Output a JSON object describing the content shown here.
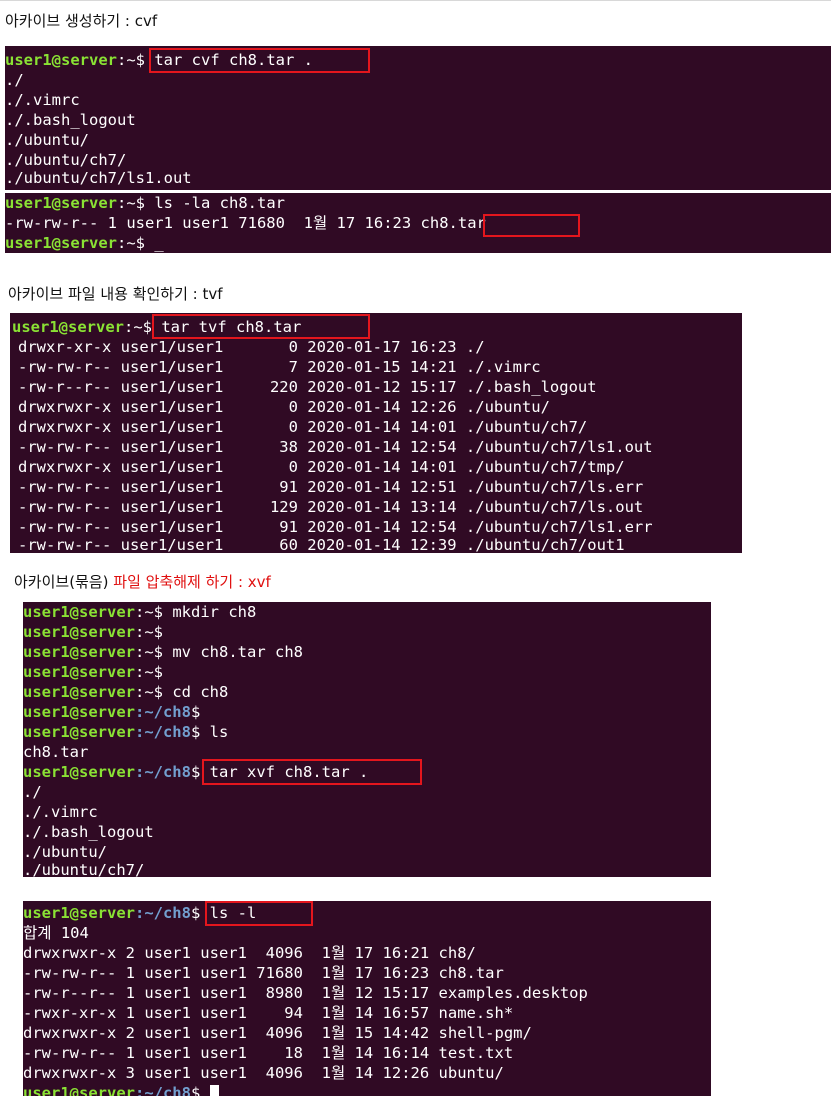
{
  "headings": {
    "create": "아카이브 생성하기 : cvf",
    "list": "아카이브 파일 내용 확인하기 : tvf",
    "extract_prefix": "아카이브(묶음) ",
    "extract_red": "파일 압축해제 하기 : xvf"
  },
  "prompt": {
    "user": "user1@server",
    "home_suffix": ":~",
    "ch8_suffix": ":~/ch8",
    "ch8_partial": ":~/ch",
    "dollar": "$"
  },
  "terminal_create": {
    "command": " tar cvf ch8.tar .",
    "output": [
      "./",
      "./.vimrc",
      "./.bash_logout",
      "./ubuntu/",
      "./ubuntu/ch7/",
      "./ubuntu/ch7/ls1.out"
    ]
  },
  "terminal_ls_la": {
    "command": " ls -la ch8.tar",
    "output_prefix": "-rw-rw-r-- 1 user1 user1 71680  1월 17 16:23 ",
    "output_file": "ch8.tar",
    "trailing": " _"
  },
  "terminal_tvf": {
    "command": " tar tvf ch8.tar",
    "rows": [
      "drwxr-xr-x user1/user1       0 2020-01-17 16:23 ./",
      "-rw-rw-r-- user1/user1       7 2020-01-15 14:21 ./.vimrc",
      "-rw-r--r-- user1/user1     220 2020-01-12 15:17 ./.bash_logout",
      "drwxrwxr-x user1/user1       0 2020-01-14 12:26 ./ubuntu/",
      "drwxrwxr-x user1/user1       0 2020-01-14 14:01 ./ubuntu/ch7/",
      "-rw-rw-r-- user1/user1      38 2020-01-14 12:54 ./ubuntu/ch7/ls1.out",
      "drwxrwxr-x user1/user1       0 2020-01-14 14:01 ./ubuntu/ch7/tmp/",
      "-rw-rw-r-- user1/user1      91 2020-01-14 12:51 ./ubuntu/ch7/ls.err",
      "-rw-rw-r-- user1/user1     129 2020-01-14 13:14 ./ubuntu/ch7/ls.out",
      "-rw-rw-r-- user1/user1      91 2020-01-14 12:54 ./ubuntu/ch7/ls1.err",
      "-rw-rw-r-- user1/user1      60 2020-01-14 12:39 ./ubuntu/ch7/out1"
    ]
  },
  "terminal_xvf": {
    "cmd_mkdir": " mkdir ch8",
    "cmd_mv": " mv ch8.tar ch8",
    "cmd_cd": " cd ch8",
    "cmd_ls": " ls",
    "ls_output": "ch8.tar",
    "partial_8": "8",
    "cmd_xvf": " tar xvf ch8.tar .",
    "output": [
      "./",
      "./.vimrc",
      "./.bash_logout",
      "./ubuntu/",
      "./ubuntu/ch7/"
    ]
  },
  "terminal_ls_l": {
    "command": " ls -l",
    "total": "합계 104",
    "rows": [
      "drwxrwxr-x 2 user1 user1  4096  1월 17 16:21 ch8/",
      "-rw-rw-r-- 1 user1 user1 71680  1월 17 16:23 ch8.tar",
      "-rw-r--r-- 1 user1 user1  8980  1월 12 15:17 examples.desktop",
      "-rwxr-xr-x 1 user1 user1    94  1월 14 16:57 name.sh*",
      "drwxrwxr-x 2 user1 user1  4096  1월 15 14:42 shell-pgm/",
      "-rw-rw-r-- 1 user1 user1    18  1월 14 16:14 test.txt",
      "drwxrwxr-x 3 user1 user1  4096  1월 14 12:26 ubuntu/"
    ]
  },
  "colors": {
    "terminal_bg": "#300a24",
    "prompt_user": "#8ae234",
    "prompt_path": "#729fcf",
    "highlight_box": "#e3161d",
    "heading_red": "#e01010"
  }
}
